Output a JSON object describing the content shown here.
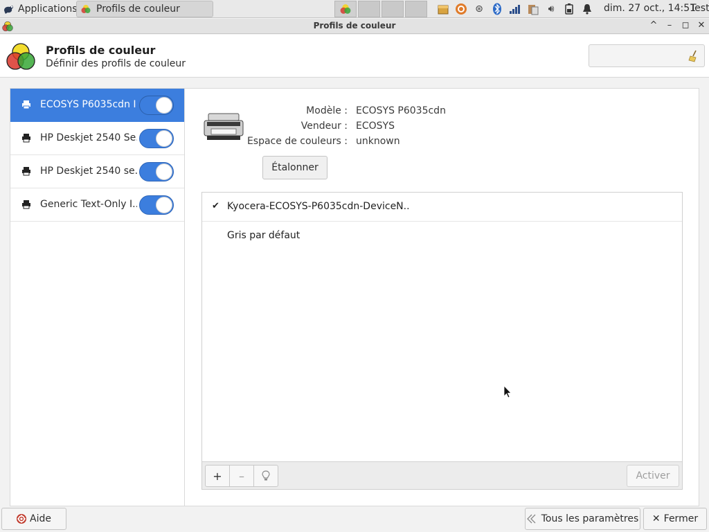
{
  "panel": {
    "applications_label": "Applications",
    "task_title": "Profils de couleur",
    "clock": "dim. 27 oct., 14:51",
    "user": "Test",
    "tray_icons": [
      "package-icon",
      "update-icon",
      "network-icon",
      "bluetooth-icon",
      "signal-icon",
      "clipboard-icon",
      "volume-icon",
      "battery-icon",
      "bell-icon"
    ]
  },
  "window": {
    "title": "Profils de couleur",
    "controls": [
      "^",
      "–",
      "◻",
      "✕"
    ]
  },
  "header": {
    "title": "Profils de couleur",
    "subtitle": "Définir des profils de couleur"
  },
  "devices": [
    {
      "label": "ECOSYS P6035cdn I...",
      "enabled": true,
      "selected": true
    },
    {
      "label": "HP Deskjet 2540 Se...",
      "enabled": true,
      "selected": false
    },
    {
      "label": "HP Deskjet 2540 se...",
      "enabled": true,
      "selected": false
    },
    {
      "label": "Generic Text-Only I...",
      "enabled": true,
      "selected": false
    }
  ],
  "details": {
    "model_label": "Modèle :",
    "model_value": "ECOSYS P6035cdn",
    "vendor_label": "Vendeur :",
    "vendor_value": "ECOSYS",
    "colorspace_label": "Espace de couleurs :",
    "colorspace_value": "unknown",
    "calibrate_button": "Étalonner"
  },
  "profiles": [
    {
      "check": "✔",
      "name": "Kyocera-ECOSYS-P6035cdn-DeviceN.."
    },
    {
      "check": "",
      "name": "Gris par défaut"
    }
  ],
  "toolbar": {
    "add": "+",
    "remove": "–",
    "info": "💡",
    "activate": "Activer"
  },
  "bottom": {
    "help": "Aide",
    "all_settings": "Tous les paramètres",
    "close": "Fermer"
  },
  "colors": {
    "accent": "#3c7ede",
    "selected_text": "#ffffff"
  }
}
